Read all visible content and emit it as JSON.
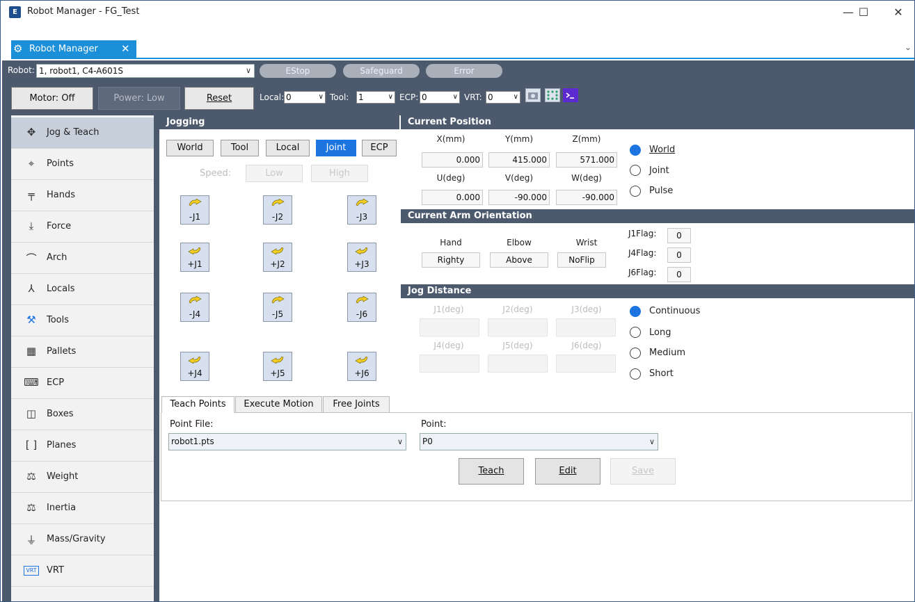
{
  "window": {
    "title": "Robot Manager - FG_Test",
    "tab_label": "Robot Manager",
    "minimize": "—",
    "maximize": "☐",
    "close": "✕"
  },
  "toolbar": {
    "robot_label": "Robot:",
    "robot_value": "1, robot1, C4-A601S",
    "estop": "EStop",
    "safeguard": "Safeguard",
    "error": "Error",
    "motor": "Motor: Off",
    "power": "Power: Low",
    "reset": "Reset",
    "local_label": "Local:",
    "local_value": "0",
    "tool_label": "Tool:",
    "tool_value": "1",
    "ecp_label": "ECP:",
    "ecp_value": "0",
    "vrt_label": "VRT:",
    "vrt_value": "0"
  },
  "sidebar": {
    "items": [
      {
        "label": "Jog & Teach",
        "icon": "move-icon"
      },
      {
        "label": "Points",
        "icon": "points-icon"
      },
      {
        "label": "Hands",
        "icon": "hands-icon"
      },
      {
        "label": "Force",
        "icon": "force-icon"
      },
      {
        "label": "Arch",
        "icon": "arch-icon"
      },
      {
        "label": "Locals",
        "icon": "locals-icon"
      },
      {
        "label": "Tools",
        "icon": "tools-icon"
      },
      {
        "label": "Pallets",
        "icon": "pallets-icon"
      },
      {
        "label": "ECP",
        "icon": "ecp-icon"
      },
      {
        "label": "Boxes",
        "icon": "boxes-icon"
      },
      {
        "label": "Planes",
        "icon": "planes-icon"
      },
      {
        "label": "Weight",
        "icon": "weight-icon"
      },
      {
        "label": "Inertia",
        "icon": "inertia-icon"
      },
      {
        "label": "Mass/Gravity",
        "icon": "mass-gravity-icon"
      },
      {
        "label": "VRT",
        "icon": "vrt-icon"
      }
    ]
  },
  "jogging": {
    "title": "Jogging",
    "modes": [
      "World",
      "Tool",
      "Local",
      "Joint",
      "ECP"
    ],
    "selected_mode": "Joint",
    "speed_label": "Speed:",
    "speed_low": "Low",
    "speed_high": "High",
    "buttons": [
      "-J1",
      "-J2",
      "-J3",
      "+J1",
      "+J2",
      "+J3",
      "-J4",
      "-J5",
      "-J6",
      "+J4",
      "+J5",
      "+J6"
    ]
  },
  "current_position": {
    "title": "Current Position",
    "headers": [
      "X(mm)",
      "Y(mm)",
      "Z(mm)",
      "U(deg)",
      "V(deg)",
      "W(deg)"
    ],
    "values": [
      "0.000",
      "415.000",
      "571.000",
      "0.000",
      "-90.000",
      "-90.000"
    ],
    "modes": [
      "World",
      "Joint",
      "Pulse"
    ],
    "selected_mode": "World"
  },
  "arm_orientation": {
    "title": "Current Arm Orientation",
    "headers": [
      "Hand",
      "Elbow",
      "Wrist"
    ],
    "values": [
      "Righty",
      "Above",
      "NoFlip"
    ],
    "flags": [
      {
        "label": "J1Flag:",
        "value": "0"
      },
      {
        "label": "J4Flag:",
        "value": "0"
      },
      {
        "label": "J6Flag:",
        "value": "0"
      }
    ]
  },
  "jog_distance": {
    "title": "Jog Distance",
    "headers": [
      "J1(deg)",
      "J2(deg)",
      "J3(deg)",
      "J4(deg)",
      "J5(deg)",
      "J6(deg)"
    ],
    "modes": [
      "Continuous",
      "Long",
      "Medium",
      "Short"
    ],
    "selected_mode": "Continuous"
  },
  "teach": {
    "tabs": [
      "Teach Points",
      "Execute Motion",
      "Free Joints"
    ],
    "point_file_label": "Point File:",
    "point_file_value": "robot1.pts",
    "point_label": "Point:",
    "point_value": "P0",
    "teach_button": "Teach",
    "edit_button": "Edit",
    "save_button": "Save"
  }
}
